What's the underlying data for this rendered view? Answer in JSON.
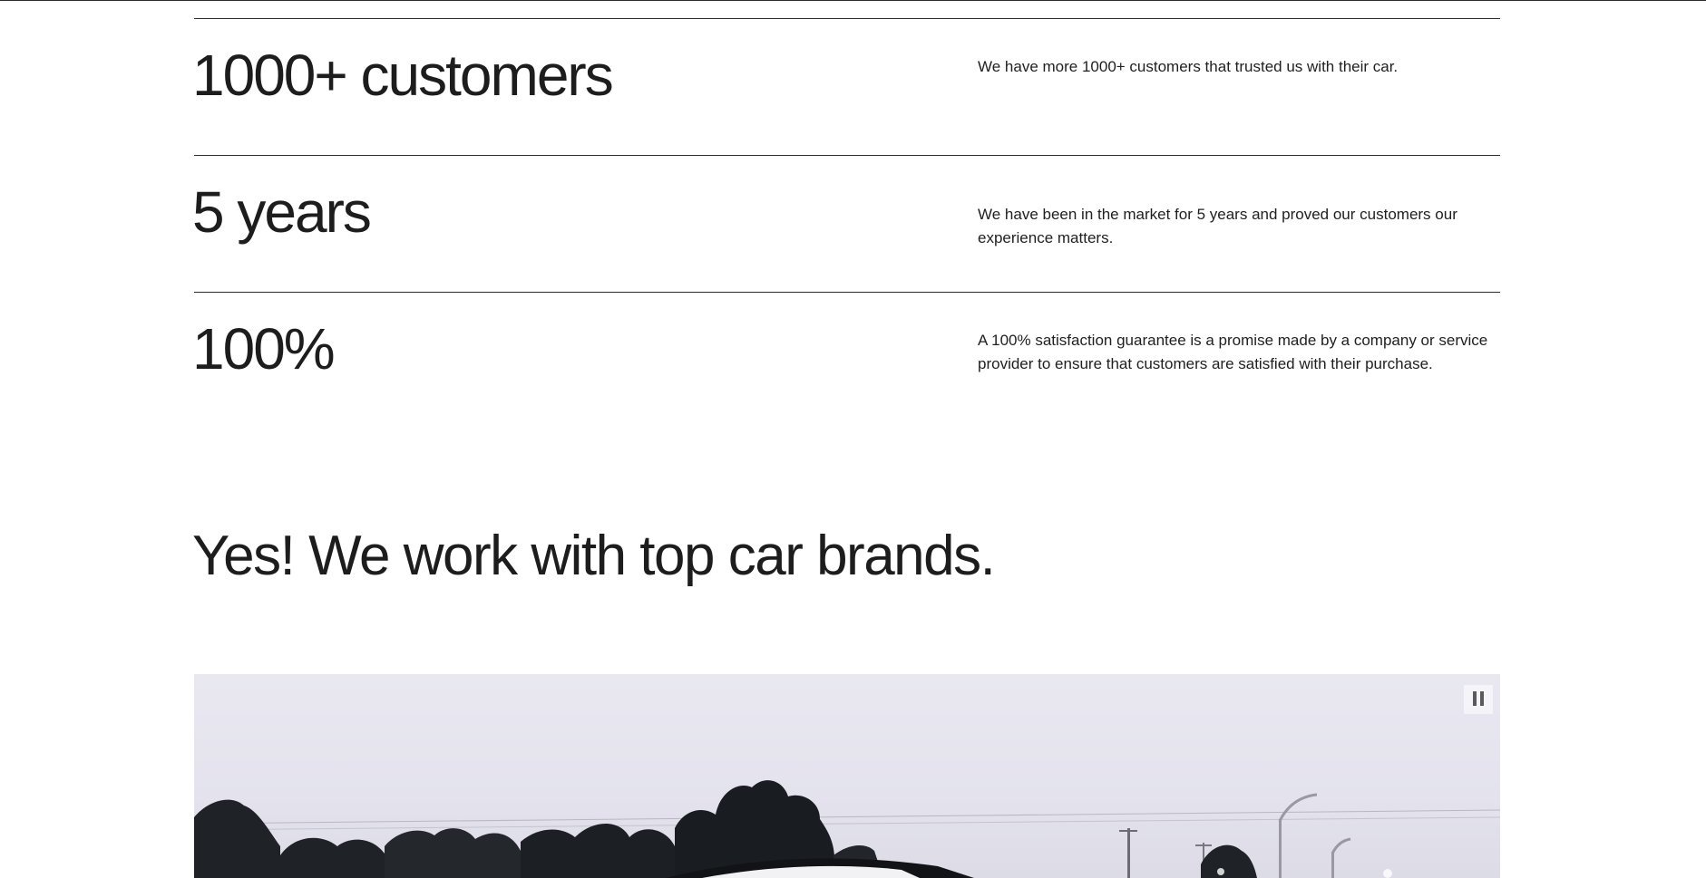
{
  "stats": [
    {
      "value": "1000+ customers",
      "description": "We have more 1000+ customers that trusted us with their car."
    },
    {
      "value": "5 years",
      "description": "We have been in the market for 5 years and proved our customers our experience matters."
    },
    {
      "value": "100%",
      "description": "A 100% satisfaction guarantee is a promise made by a company or service provider to ensure that customers are satisfied with their purchase."
    }
  ],
  "brands": {
    "heading": "Yes! We work with top car brands."
  },
  "media": {
    "pause_icon": "pause-icon"
  }
}
